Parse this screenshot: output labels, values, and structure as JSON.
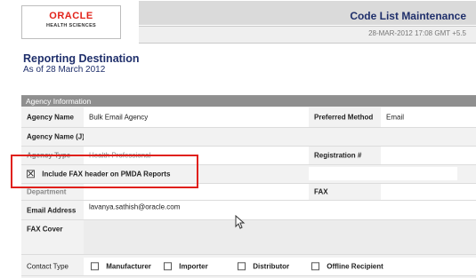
{
  "header": {
    "logo_brand": "ORACLE",
    "logo_sub": "HEALTH SCIENCES",
    "title": "Code List Maintenance",
    "datetime": "28-MAR-2012 17:08 GMT +5.5"
  },
  "page": {
    "title": "Reporting Destination",
    "as_of": "As of 28 March 2012"
  },
  "panel": {
    "title": "Agency Information",
    "agency_name_label": "Agency Name",
    "agency_name_value": "Bulk Email Agency",
    "preferred_method_label": "Preferred Method",
    "preferred_method_value": "Email",
    "agency_name_j_label": "Agency Name (J)",
    "agency_type_label": "Agency Type",
    "agency_type_value": "Health Professional",
    "registration_label": "Registration #",
    "include_fax_label": "Include FAX header on PMDA Reports",
    "department_label": "Department",
    "fax_label": "FAX",
    "email_label": "Email Address",
    "email_value": "lavanya.sathish@oracle.com",
    "fax_cover_label": "FAX Cover",
    "contact_type_label": "Contact Type",
    "contact_types": [
      {
        "label": "Manufacturer",
        "checked": false
      },
      {
        "label": "Importer",
        "checked": false
      },
      {
        "label": "Distributor",
        "checked": false
      },
      {
        "label": "Offline Recipient",
        "checked": false
      }
    ]
  },
  "colors": {
    "brand_red": "#e2231a",
    "title_blue": "#1f2f6b",
    "panel_header": "#8f8f8f",
    "highlight_red": "#e0201b"
  }
}
